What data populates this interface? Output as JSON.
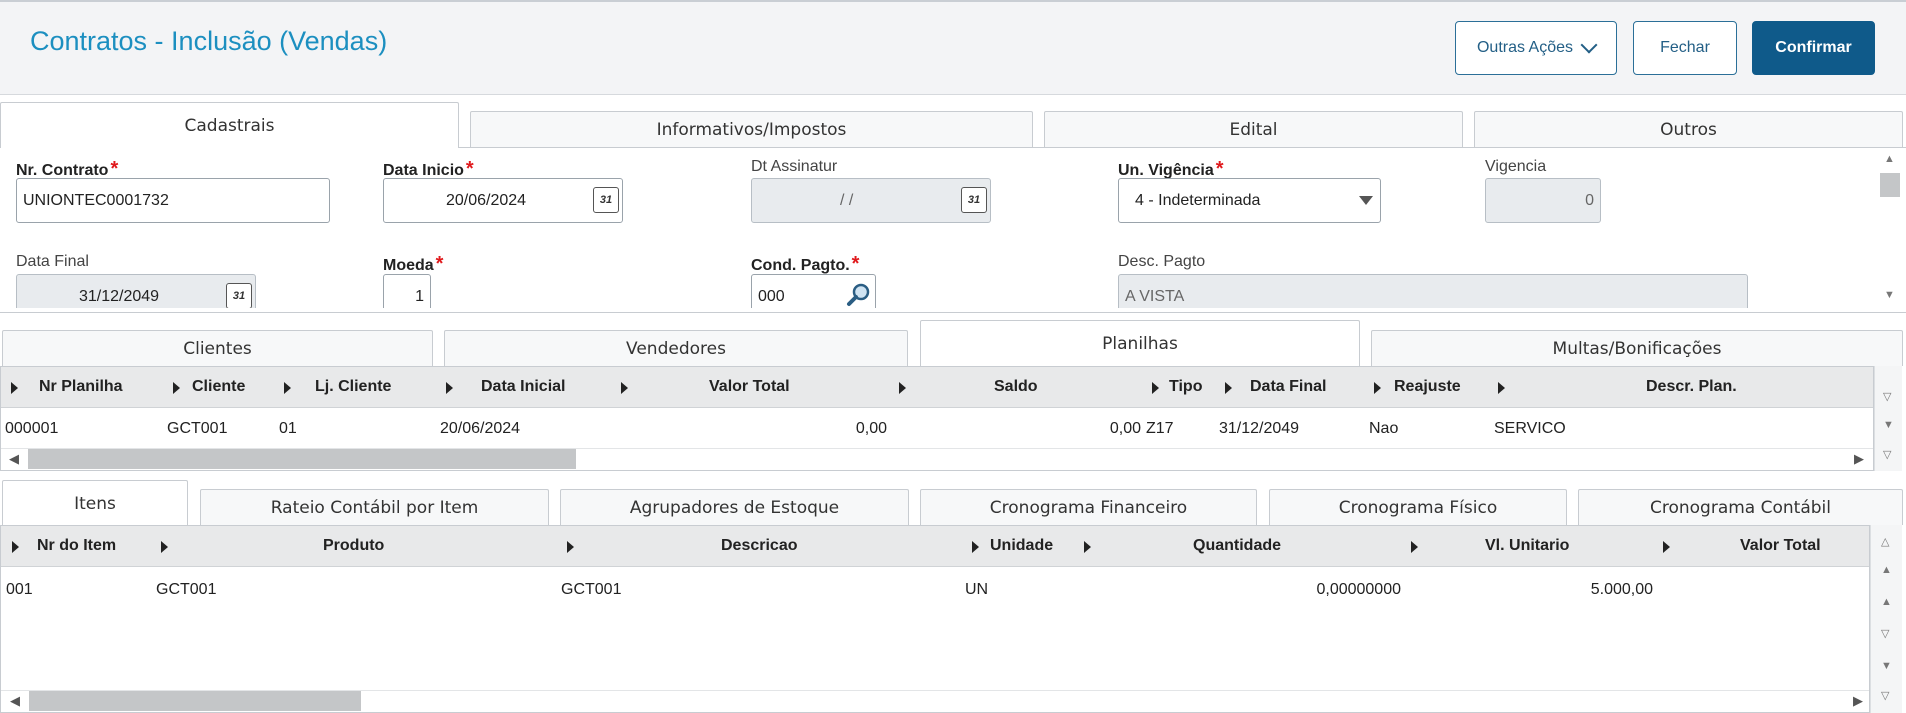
{
  "header": {
    "title": "Contratos - Inclusão (Vendas)",
    "buttons": {
      "more": "Outras Ações",
      "close": "Fechar",
      "confirm": "Confirmar"
    }
  },
  "tabs_top": [
    "Cadastrais",
    "Informativos/Impostos",
    "Edital",
    "Outros"
  ],
  "form": {
    "nr_contrato": {
      "label": "Nr. Contrato",
      "value": "UNIONTEC0001732"
    },
    "data_inicio": {
      "label": "Data Inicio",
      "value": "20/06/2024"
    },
    "dt_assinatur": {
      "label": "Dt Assinatur",
      "value": "/ /"
    },
    "un_vigencia": {
      "label": "Un. Vigência",
      "value": "4 - Indeterminada"
    },
    "vigencia": {
      "label": "Vigencia",
      "value": "0"
    },
    "data_final": {
      "label": "Data Final",
      "value": "31/12/2049"
    },
    "moeda": {
      "label": "Moeda",
      "value": "1"
    },
    "cond_pagto": {
      "label": "Cond. Pagto.",
      "value": "000"
    },
    "desc_pagto": {
      "label": "Desc. Pagto",
      "value": "A VISTA"
    },
    "required_mark": "*",
    "calendar_glyph": "31"
  },
  "tabs_mid": [
    "Clientes",
    "Vendedores",
    "Planilhas",
    "Multas/Bonificações"
  ],
  "planilhas": {
    "columns": [
      "Nr Planilha",
      "Cliente",
      "Lj. Cliente",
      "Data Inicial",
      "Valor Total",
      "Saldo",
      "Tipo",
      "Data Final",
      "Reajuste",
      "Descr. Plan."
    ],
    "rows": [
      [
        "000001",
        "GCT001",
        "01",
        "20/06/2024",
        "0,00",
        "0,00",
        "Z17",
        "31/12/2049",
        "Nao",
        "SERVICO"
      ]
    ]
  },
  "tabs_bottom": [
    "Itens",
    "Rateio Contábil por Item",
    "Agrupadores de Estoque",
    "Cronograma Financeiro",
    "Cronograma Físico",
    "Cronograma Contábil"
  ],
  "itens": {
    "columns": [
      "Nr do Item",
      "Produto",
      "Descricao",
      "Unidade",
      "Quantidade",
      "Vl. Unitario",
      "Valor Total"
    ],
    "rows": [
      [
        "001",
        "GCT001",
        "GCT001",
        "UN",
        "0,00000000",
        "5.000,00",
        ""
      ]
    ]
  },
  "icons": {
    "search": "magnifier-icon",
    "calendar": "calendar-icon",
    "dropdown": "chevron-down-icon"
  }
}
